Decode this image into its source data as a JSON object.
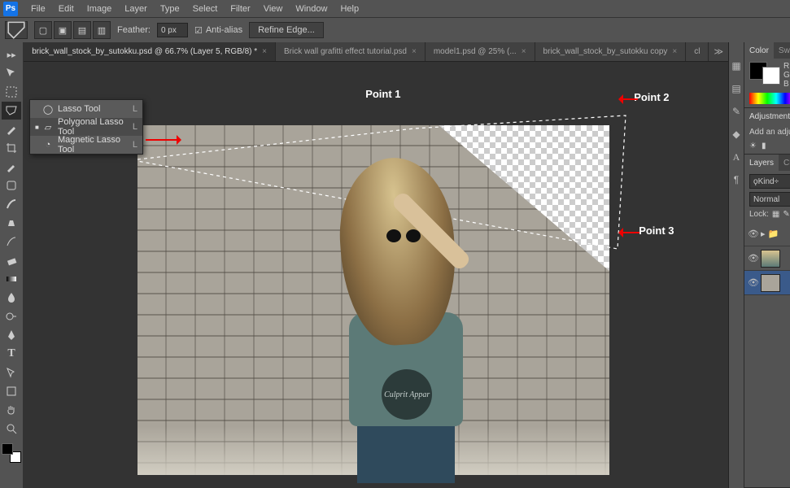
{
  "logo": "Ps",
  "menu": [
    "File",
    "Edit",
    "Image",
    "Layer",
    "Type",
    "Select",
    "Filter",
    "View",
    "Window",
    "Help"
  ],
  "options": {
    "feather_label": "Feather:",
    "feather_value": "0 px",
    "antialias": "Anti-alias",
    "refine": "Refine Edge..."
  },
  "tabs": [
    {
      "label": "brick_wall_stock_by_sutokku.psd @ 66.7% (Layer 5, RGB/8) *",
      "active": true
    },
    {
      "label": "Brick wall grafitti effect tutorial.psd",
      "active": false
    },
    {
      "label": "model1.psd @ 25% (...",
      "active": false
    },
    {
      "label": "brick_wall_stock_by_sutokku copy",
      "active": false
    },
    {
      "label": "cl",
      "active": false
    }
  ],
  "flyout": {
    "items": [
      {
        "label": "Lasso Tool",
        "key": "L",
        "selected": false
      },
      {
        "label": "Polygonal Lasso Tool",
        "key": "L",
        "selected": true
      },
      {
        "label": "Magnetic Lasso Tool",
        "key": "L",
        "selected": false
      }
    ]
  },
  "annotations": {
    "p1": "Point 1",
    "p2": "Point 2",
    "p3": "Point 3"
  },
  "shirt_logo": "Culprit Appar",
  "panels": {
    "color": {
      "tabs": [
        "Color",
        "Swat"
      ],
      "channels": [
        "R",
        "G",
        "B"
      ]
    },
    "adjustments": {
      "title": "Adjustments",
      "hint": "Add an adjus"
    },
    "layers": {
      "tabs": [
        "Layers",
        "Chan"
      ],
      "filter": "Kind",
      "blend": "Normal",
      "lock_label": "Lock:",
      "rows": [
        {
          "visible": true,
          "group": true
        },
        {
          "visible": true,
          "thumb": "photo"
        },
        {
          "visible": true,
          "thumb": "brick",
          "selected": true
        }
      ]
    }
  }
}
